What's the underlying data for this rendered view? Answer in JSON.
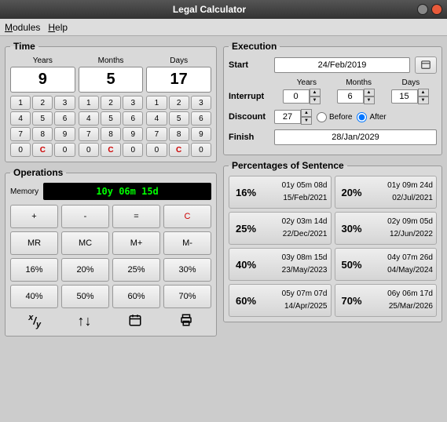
{
  "window": {
    "title": "Legal Calculator"
  },
  "menu": {
    "modules": "Modules",
    "help": "Help"
  },
  "time": {
    "legend": "Time",
    "years_label": "Years",
    "months_label": "Months",
    "days_label": "Days",
    "years": "9",
    "months": "5",
    "days": "17",
    "buttons": [
      "1",
      "2",
      "3",
      "4",
      "5",
      "6",
      "7",
      "8",
      "9",
      "0",
      "C",
      "0"
    ],
    "clear": "C"
  },
  "operations": {
    "legend": "Operations",
    "memory_label": "Memory",
    "memory_value": "10y 06m 15d",
    "btns": [
      "+",
      "-",
      "=",
      "C",
      "MR",
      "MC",
      "M+",
      "M-",
      "16%",
      "20%",
      "25%",
      "30%",
      "40%",
      "50%",
      "60%",
      "70%"
    ],
    "icons": {
      "fraction": "x/y",
      "swap": "↑↓",
      "calendar": "📅",
      "print": "🖨"
    }
  },
  "execution": {
    "legend": "Execution",
    "start_label": "Start",
    "start_value": "24/Feb/2019",
    "years_label": "Years",
    "months_label": "Months",
    "days_label": "Days",
    "interrupt_label": "Interrupt",
    "interrupt_y": "0",
    "interrupt_m": "6",
    "interrupt_d": "15",
    "discount_label": "Discount",
    "discount_value": "27",
    "before_label": "Before",
    "after_label": "After",
    "finish_label": "Finish",
    "finish_value": "28/Jan/2029"
  },
  "percentages": {
    "legend": "Percentages of Sentence",
    "cells": [
      {
        "pct": "16%",
        "duration": "01y 05m 08d",
        "date": "15/Feb/2021"
      },
      {
        "pct": "20%",
        "duration": "01y 09m 24d",
        "date": "02/Jul/2021"
      },
      {
        "pct": "25%",
        "duration": "02y 03m 14d",
        "date": "22/Dec/2021"
      },
      {
        "pct": "30%",
        "duration": "02y 09m 05d",
        "date": "12/Jun/2022"
      },
      {
        "pct": "40%",
        "duration": "03y 08m 15d",
        "date": "23/May/2023"
      },
      {
        "pct": "50%",
        "duration": "04y 07m 26d",
        "date": "04/May/2024"
      },
      {
        "pct": "60%",
        "duration": "05y 07m 07d",
        "date": "14/Apr/2025"
      },
      {
        "pct": "70%",
        "duration": "06y 06m 17d",
        "date": "25/Mar/2026"
      }
    ]
  }
}
